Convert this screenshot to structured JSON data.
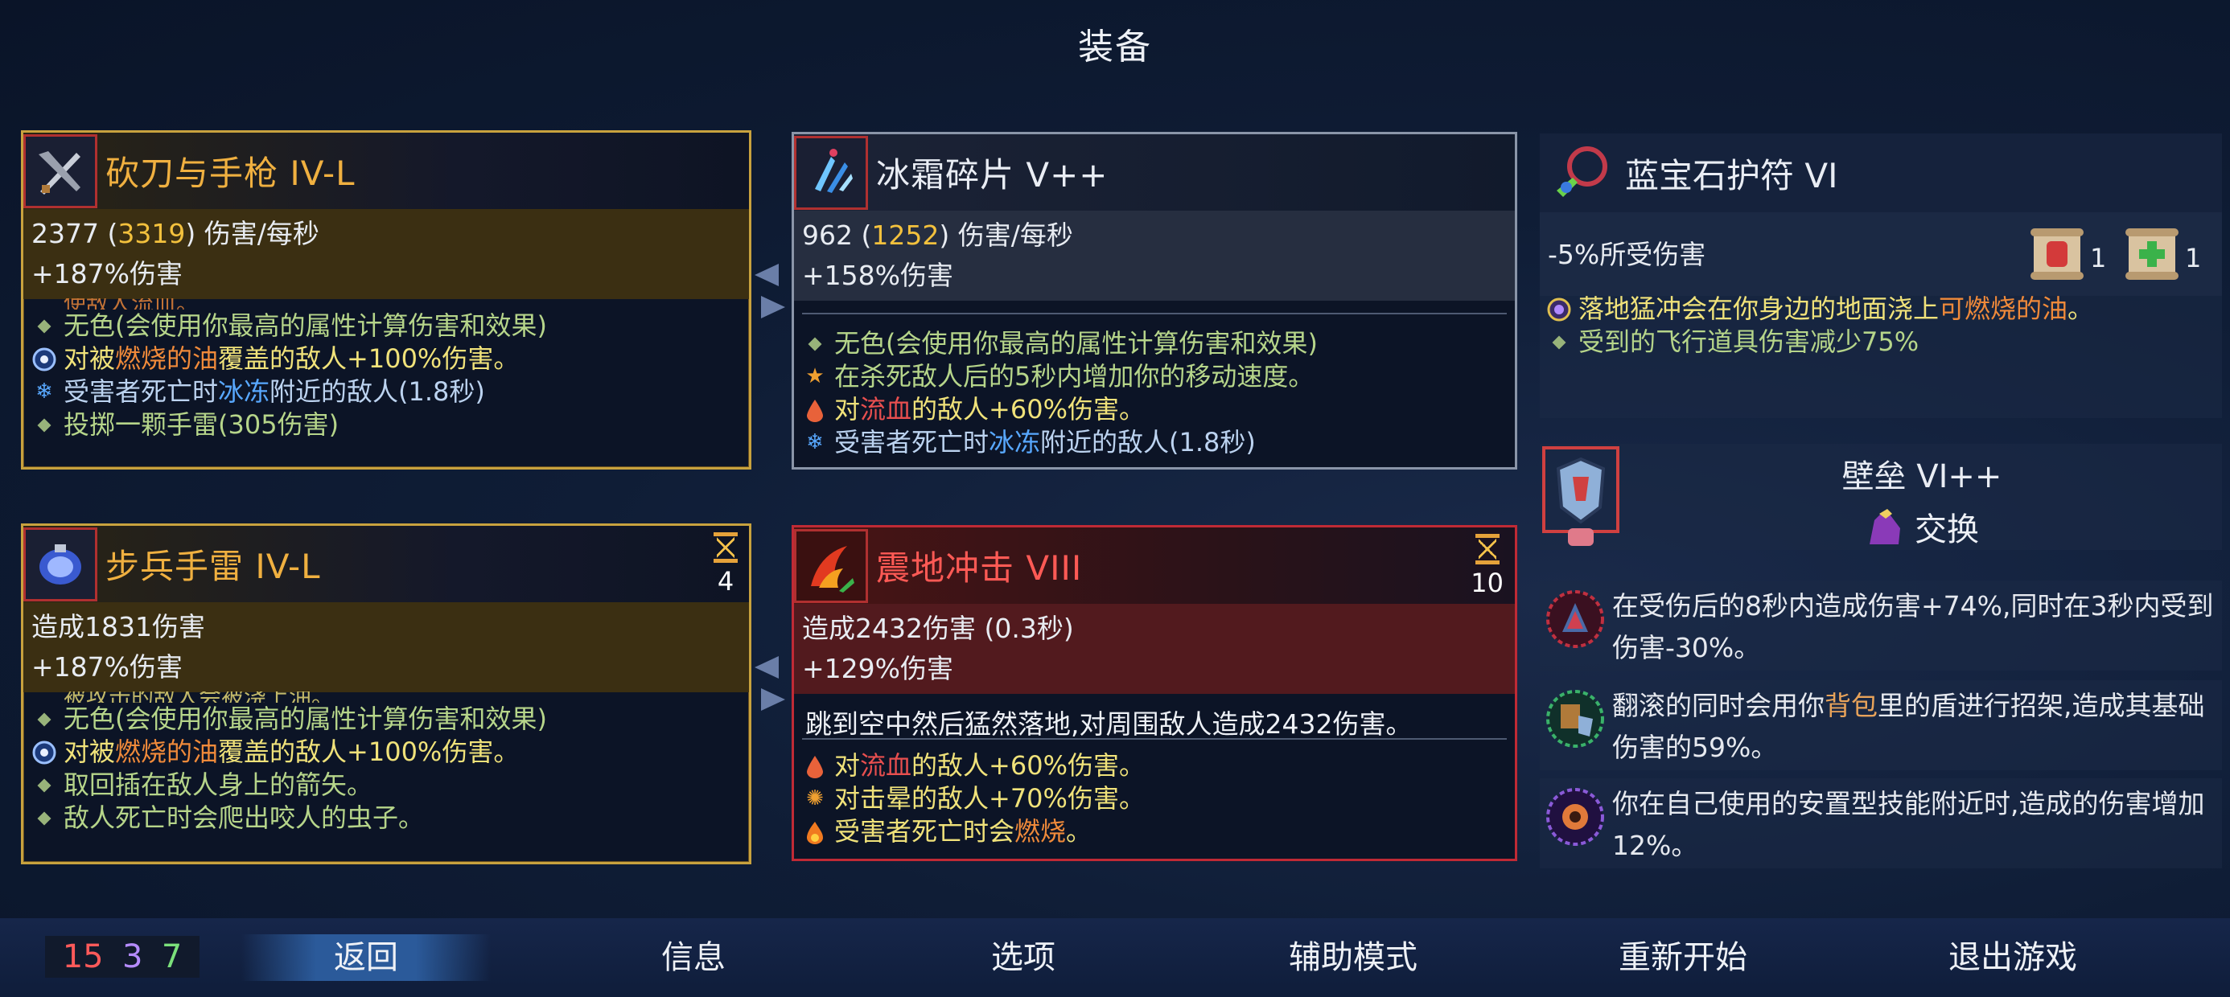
{
  "screen_title": "装备",
  "weapon1": {
    "name": "砍刀与手枪 IV-L",
    "dps_base": "2377 (",
    "dps_high": "3319",
    "dps_suffix": ") 伤害/每秒",
    "bonus": "+187%伤害",
    "cut_line": "使敌人流血。",
    "effects": [
      "无色(会使用你最高的属性计算伤害和效果)",
      "对被",
      "燃烧的油",
      "覆盖的敌人+100%伤害。",
      "受害者死亡时",
      "冰冻",
      "附近的敌人(1.8秒)",
      "投掷一颗手雷(305伤害)"
    ]
  },
  "weapon2": {
    "name": "冰霜碎片 V++",
    "dps_base": "962 (",
    "dps_high": "1252",
    "dps_suffix": ") 伤害/每秒",
    "bonus": "+158%伤害",
    "effects": [
      "无色(会使用你最高的属性计算伤害和效果)",
      "在杀死敌人后的5秒内增加你的移动速度。",
      "对",
      "流血",
      "的敌人+60%伤害。",
      "受害者死亡时",
      "冰冻",
      "附近的敌人(1.8秒)"
    ]
  },
  "amulet": {
    "name": "蓝宝石护符 VI",
    "stat": "-5%所受伤害",
    "scroll_red_count": "1",
    "scroll_green_count": "1",
    "effect1_a": "落地猛冲会在你身边的地面浇上",
    "effect1_b": "可燃烧的油",
    "effect1_c": "。",
    "effect2": "受到的飞行道具伤害减少75%"
  },
  "skill1": {
    "name": "步兵手雷 IV-L",
    "cooldown": "4",
    "stat": "造成1831伤害",
    "bonus": "+187%伤害",
    "cut_line": "被攻击的敌人会被浇上油。",
    "effects": [
      "无色(会使用你最高的属性计算伤害和效果)",
      "对被",
      "燃烧的油",
      "覆盖的敌人+100%伤害。",
      "取回插在敌人身上的箭矢。",
      "敌人死亡时会爬出咬人的虫子。"
    ]
  },
  "skill2": {
    "name": "震地冲击 VIII",
    "cooldown": "10",
    "stat": "造成2432伤害 (0.3秒)",
    "bonus": "+129%伤害",
    "desc": "跳到空中然后猛然落地,对周围敌人造成2432伤害。",
    "effects": [
      "对",
      "流血",
      "的敌人+60%伤害。",
      "对击晕的敌人+70%伤害。",
      "受害者死亡时会",
      "燃烧",
      "。"
    ]
  },
  "shield": {
    "name": "壁垒 VI++",
    "swap_label": "交换"
  },
  "mutations": [
    {
      "text": "在受伤后的8秒内造成伤害+74%,同时在3秒内受到伤害-30%。"
    },
    {
      "text_a": "翻滚的同时会用你",
      "text_b": "背包",
      "text_c": "里的盾进行招架,造成其基础伤害的59%。"
    },
    {
      "text": "你在自己使用的安置型技能附近时,造成的伤害增加12%。"
    }
  ],
  "stats_counter": {
    "brutality": "15",
    "tactics": "3",
    "survival": "7"
  },
  "nav": {
    "back": "返回",
    "info": "信息",
    "options": "选项",
    "assist": "辅助模式",
    "restart": "重新开始",
    "quit": "退出游戏"
  },
  "colors": {
    "gold_border": "#c8a23e",
    "silver_border": "#8a95a8",
    "red_border": "#c02a35",
    "highlight_yellow": "#f3c13d",
    "oil_orange": "#f08a3a",
    "freeze_blue": "#58a8ff",
    "brutality_red": "#ff5a5a",
    "tactics_purple": "#b58cff",
    "survival_green": "#7be07b"
  }
}
